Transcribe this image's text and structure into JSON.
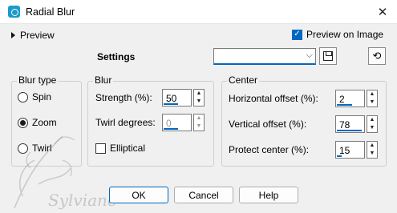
{
  "window": {
    "title": "Radial Blur",
    "icon": "app-icon",
    "close_glyph": "✕"
  },
  "preview": {
    "label": "Preview",
    "preview_on_image_label": "Preview on Image",
    "preview_on_image_checked": true
  },
  "settings": {
    "label": "Settings",
    "value": ""
  },
  "blur_type": {
    "title": "Blur type",
    "options": [
      {
        "label": "Spin",
        "checked": false
      },
      {
        "label": "Zoom",
        "checked": true
      },
      {
        "label": "Twirl",
        "checked": false
      }
    ]
  },
  "blur": {
    "title": "Blur",
    "strength_label": "Strength (%):",
    "strength_value": "50",
    "twirl_label": "Twirl degrees:",
    "twirl_value": "0",
    "elliptical_label": "Elliptical",
    "elliptical_checked": false
  },
  "center": {
    "title": "Center",
    "horizontal_label": "Horizontal offset (%):",
    "horizontal_value": "2",
    "vertical_label": "Vertical offset (%):",
    "vertical_value": "78",
    "protect_label": "Protect center (%):",
    "protect_value": "15"
  },
  "buttons": {
    "ok": "OK",
    "cancel": "Cancel",
    "help": "Help"
  },
  "colors": {
    "accent": "#0067c0",
    "app_icon": "#1a9bc9"
  },
  "watermark_text": "Sylviane"
}
